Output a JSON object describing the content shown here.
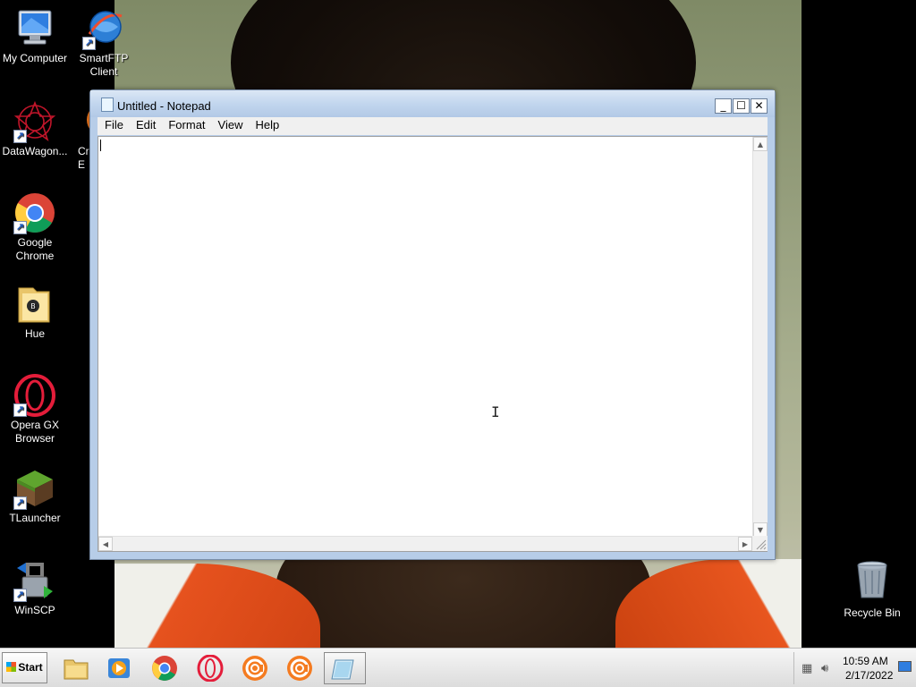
{
  "desktop": {
    "icons": [
      {
        "label": "My Computer",
        "icon": "computer-icon"
      },
      {
        "label": "SmartFTP Client",
        "icon": "smartftp-icon"
      },
      {
        "label": "DataWagon...",
        "icon": "datawagon-icon"
      },
      {
        "label": "Cr\nE",
        "icon": "ccleaner-icon"
      },
      {
        "label": "Google Chrome",
        "icon": "chrome-icon"
      },
      {
        "label": "Hue",
        "icon": "folder-icon"
      },
      {
        "label": "Opera GX Browser",
        "icon": "opera-gx-icon"
      },
      {
        "label": "TLauncher",
        "icon": "minecraft-icon"
      },
      {
        "label": "WinSCP",
        "icon": "winscp-icon"
      },
      {
        "label": "Recycle Bin",
        "icon": "recycle-bin-icon"
      }
    ]
  },
  "notepad": {
    "title": "Untitled - Notepad",
    "menu": [
      "File",
      "Edit",
      "Format",
      "View",
      "Help"
    ],
    "content": "",
    "controls": {
      "minimize": "_",
      "maximize": "☐",
      "close": "✕"
    }
  },
  "taskbar": {
    "start_label": "Start",
    "items": [
      {
        "name": "file-explorer",
        "icon": "folder-icon"
      },
      {
        "name": "media-player",
        "icon": "media-player-icon"
      },
      {
        "name": "chrome",
        "icon": "chrome-icon"
      },
      {
        "name": "opera",
        "icon": "opera-icon"
      },
      {
        "name": "ccleaner-1",
        "icon": "ccleaner-icon"
      },
      {
        "name": "ccleaner-2",
        "icon": "ccleaner-icon"
      },
      {
        "name": "notepad",
        "icon": "notepad-icon",
        "active": true
      }
    ],
    "tray": {
      "time": "10:59 AM",
      "date": "2/17/2022"
    }
  },
  "colors": {
    "title_bar": "#c2d6ee",
    "taskbar": "#e8e8e8",
    "opera_red": "#e41d3a",
    "ccleaner_orange": "#f47b20"
  }
}
